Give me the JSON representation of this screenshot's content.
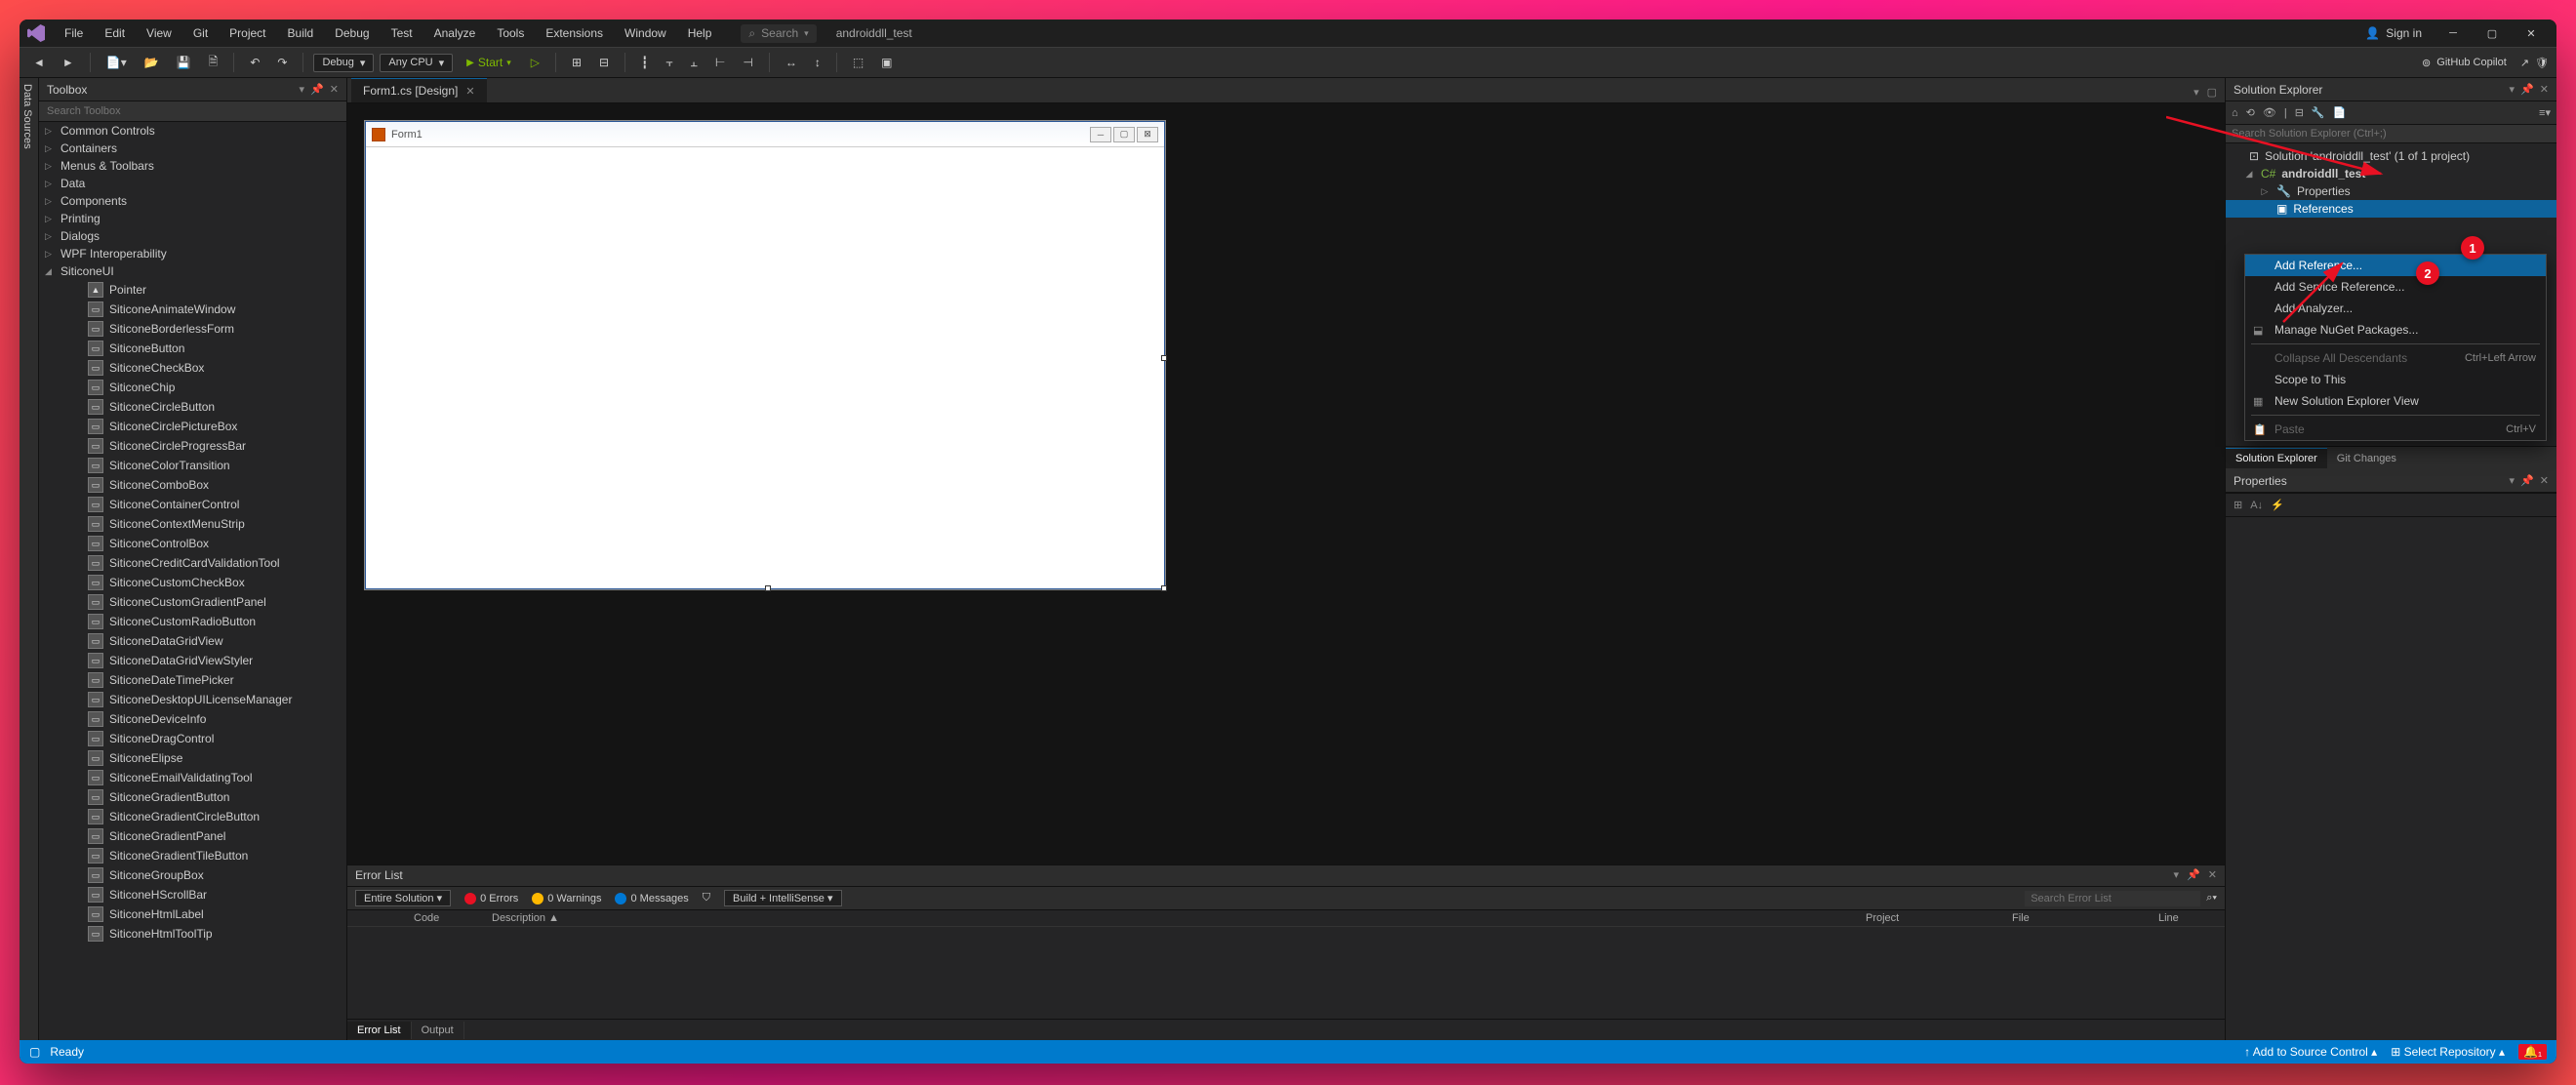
{
  "titlebar": {
    "search_placeholder": "Search",
    "project": "androiddll_test",
    "signin": "Sign in",
    "copilot": "GitHub Copilot"
  },
  "menu": [
    "File",
    "Edit",
    "View",
    "Git",
    "Project",
    "Build",
    "Debug",
    "Test",
    "Analyze",
    "Tools",
    "Extensions",
    "Window",
    "Help"
  ],
  "toolbar": {
    "config": "Debug",
    "platform": "Any CPU",
    "start": "Start"
  },
  "side_tab": "Data Sources",
  "toolbox": {
    "title": "Toolbox",
    "search": "Search Toolbox",
    "groups": [
      "Common Controls",
      "Containers",
      "Menus & Toolbars",
      "Data",
      "Components",
      "Printing",
      "Dialogs",
      "WPF Interoperability",
      "SiticoneUI"
    ],
    "siticone_items": [
      "Pointer",
      "SiticoneAnimateWindow",
      "SiticoneBorderlessForm",
      "SiticoneButton",
      "SiticoneCheckBox",
      "SiticoneChip",
      "SiticoneCircleButton",
      "SiticoneCirclePictureBox",
      "SiticoneCircleProgressBar",
      "SiticoneColorTransition",
      "SiticoneComboBox",
      "SiticoneContainerControl",
      "SiticoneContextMenuStrip",
      "SiticoneControlBox",
      "SiticoneCreditCardValidationTool",
      "SiticoneCustomCheckBox",
      "SiticoneCustomGradientPanel",
      "SiticoneCustomRadioButton",
      "SiticoneDataGridView",
      "SiticoneDataGridViewStyler",
      "SiticoneDateTimePicker",
      "SiticoneDesktopUILicenseManager",
      "SiticoneDeviceInfo",
      "SiticoneDragControl",
      "SiticoneElipse",
      "SiticoneEmailValidatingTool",
      "SiticoneGradientButton",
      "SiticoneGradientCircleButton",
      "SiticoneGradientPanel",
      "SiticoneGradientTileButton",
      "SiticoneGroupBox",
      "SiticoneHScrollBar",
      "SiticoneHtmlLabel",
      "SiticoneHtmlToolTip"
    ]
  },
  "tab": {
    "label": "Form1.cs [Design]"
  },
  "form": {
    "title": "Form1"
  },
  "errorlist": {
    "title": "Error List",
    "scope": "Entire Solution",
    "errors": "0 Errors",
    "warnings": "0 Warnings",
    "messages": "0 Messages",
    "build": "Build + IntelliSense",
    "search": "Search Error List",
    "cols": [
      "",
      "Code",
      "Description ▲",
      "Project",
      "File",
      "Line"
    ],
    "bottom_tabs": [
      "Error List",
      "Output"
    ]
  },
  "solution": {
    "title": "Solution Explorer",
    "search": "Search Solution Explorer (Ctrl+;)",
    "root": "Solution 'androiddll_test' (1 of 1 project)",
    "project": "androiddll_test",
    "properties": "Properties",
    "references": "References"
  },
  "right_tabs": [
    "Solution Explorer",
    "Git Changes"
  ],
  "properties_panel": {
    "title": "Properties"
  },
  "context_menu": {
    "items": [
      {
        "label": "Add Reference...",
        "highlight": true
      },
      {
        "label": "Add Service Reference..."
      },
      {
        "label": "Add Analyzer..."
      },
      {
        "label": "Manage NuGet Packages...",
        "icon": "⬓"
      },
      {
        "sep": true
      },
      {
        "label": "Collapse All Descendants",
        "disabled": true,
        "key": "Ctrl+Left Arrow"
      },
      {
        "label": "Scope to This"
      },
      {
        "label": "New Solution Explorer View",
        "icon": "▦"
      },
      {
        "sep": true
      },
      {
        "label": "Paste",
        "disabled": true,
        "icon": "📋",
        "key": "Ctrl+V"
      }
    ]
  },
  "badges": {
    "one": "1",
    "two": "2"
  },
  "statusbar": {
    "ready": "Ready",
    "add_source": "Add to Source Control",
    "select_repo": "Select Repository"
  }
}
